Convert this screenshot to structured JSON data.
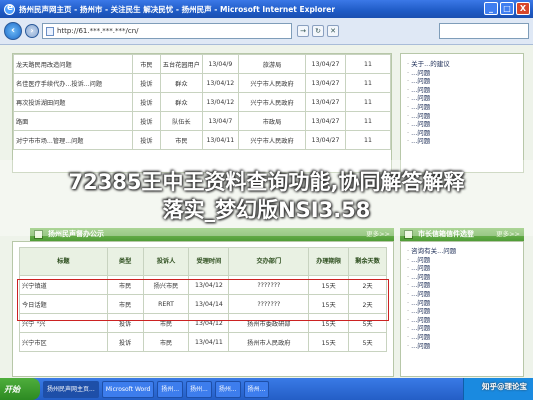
{
  "window": {
    "title": "扬州民声网主页 - 扬州市 - 关注民生 解决民忧 - 扬州民声 - Microsoft Internet Explorer",
    "buttons": [
      "_",
      "□",
      "X"
    ]
  },
  "address": {
    "url": "http://61.***.***.***/cn/"
  },
  "top_table": {
    "rows": [
      [
        "龙天路民用改造问题",
        "市民",
        "五台花园用户",
        "13/04/9",
        "旅游局",
        "13/04/27",
        "11"
      ],
      [
        "名佳医疗手续代办...投诉...问题",
        "投诉",
        "群众",
        "13/04/12",
        "兴宁市人民政府",
        "13/04/27",
        "11"
      ],
      [
        "再次投诉湖田问题",
        "投诉",
        "群众",
        "13/04/12",
        "兴宁市人民政府",
        "13/04/27",
        "11"
      ],
      [
        "路面",
        "投诉",
        "队伍长",
        "13/04/7",
        "市政局",
        "13/04/27",
        "11"
      ],
      [
        "对宁市市场...管理...问题",
        "投诉",
        "市民",
        "13/04/11",
        "兴宁市人民政府",
        "13/04/27",
        "11"
      ]
    ]
  },
  "right_top_list": [
    "关于...的建议",
    "...问题",
    "...问题",
    "...问题",
    "...问题",
    "...问题",
    "...问题",
    "...问题",
    "...问题",
    "...问题"
  ],
  "bottom_section": {
    "left_title": "扬州民声督办公示",
    "left_more": "更多>>",
    "right_title": "市长信箱信件选登",
    "right_more": "更多>>",
    "headers": [
      "标题",
      "类型",
      "投诉人",
      "受理时间",
      "交办部门",
      "办理期限",
      "剩余天数"
    ],
    "rows": [
      [
        "兴宁镇道",
        "市民",
        "扬兴市民",
        "13/04/12",
        "???????",
        "15天",
        "2天"
      ],
      [
        "今日话题",
        "市民",
        "RERT",
        "13/04/14",
        "???????",
        "15天",
        "2天"
      ],
      [
        "兴宁 \"兴",
        "投诉",
        "市民",
        "13/04/12",
        "扬州市委政研部",
        "15天",
        "5天"
      ],
      [
        "兴宁市区",
        "投诉",
        "市民",
        "13/04/11",
        "扬州市人民政府",
        "15天",
        "5天"
      ]
    ]
  },
  "right_bottom_list": [
    "咨询有关...问题",
    "...问题",
    "...问题",
    "...问题",
    "...问题",
    "...问题",
    "...问题",
    "...问题",
    "...问题",
    "...问题",
    "...问题",
    "...问题"
  ],
  "overlay": {
    "line1": "72385王中王资料查询功能,协同解答解释",
    "line2": "落实_梦幻版NSI3.58"
  },
  "taskbar": {
    "start": "开始",
    "items": [
      "扬州民声网主页...",
      "Microsoft Word",
      "扬州...",
      "扬州...",
      "扬州...",
      "扬州..."
    ],
    "tray_time": ""
  },
  "watermark": "知乎@理论宝"
}
